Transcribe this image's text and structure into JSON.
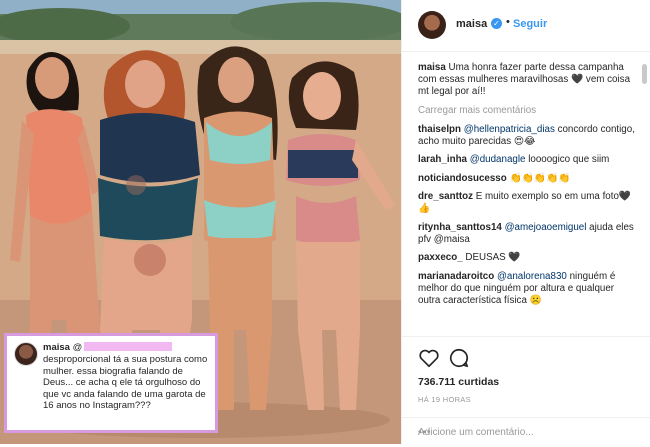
{
  "post": {
    "author": "maisa",
    "follow_label": "Seguir",
    "dot": "•",
    "caption_user": "maisa",
    "caption_text": "Uma honra fazer parte dessa campanha com essas mulheres maravilhosas 🖤 vem coisa mt legal por aí!!",
    "load_more": "Carregar mais comentários",
    "comments": [
      {
        "user": "thaiselpn",
        "tag": "@hellenpatricia_dias",
        "text": " concordo contigo, acho muito parecidas 😍😂"
      },
      {
        "user": "larah_inha",
        "tag": "@dudanagle",
        "text": " loooogico que siim"
      },
      {
        "user": "noticiandosucesso",
        "tag": "",
        "text": "👏👏👏👏👏"
      },
      {
        "user": "dre_santtoz",
        "tag": "",
        "text": "E muito exemplo so em uma foto🖤👍"
      },
      {
        "user": "ritynha_santtos14",
        "tag": "@amejoaoemiguel",
        "text": " ajuda eles pfv @maisa"
      },
      {
        "user": "paxxeco_",
        "tag": "",
        "text": "DEUSAS 🖤"
      },
      {
        "user": "marianadaroitco",
        "tag": "@analorena830",
        "text": " ninguém é melhor do que ninguém por altura e qualquer outra característica física ☹️"
      }
    ],
    "likes": "736.711 curtidas",
    "time": "HÁ 19 HORAS",
    "add_comment_placeholder": "Adicione um comentário...",
    "more_label": "•••"
  },
  "overlay_comment": {
    "user": "maisa",
    "at": "@",
    "text": "desproporcional tá a sua postura como mulher. essa biografia falando de Deus... ce acha q ele tá orgulhoso do que vc anda falando de uma garota de 16 anos no Instagram???"
  },
  "colors": {
    "link": "#003569",
    "accent": "#3897f0",
    "muted": "#999999",
    "overlay_border": "#d79adf",
    "redaction": "#f2b8f2"
  },
  "icons": [
    "heart-icon",
    "comment-icon",
    "verified-icon",
    "more-options-icon"
  ]
}
